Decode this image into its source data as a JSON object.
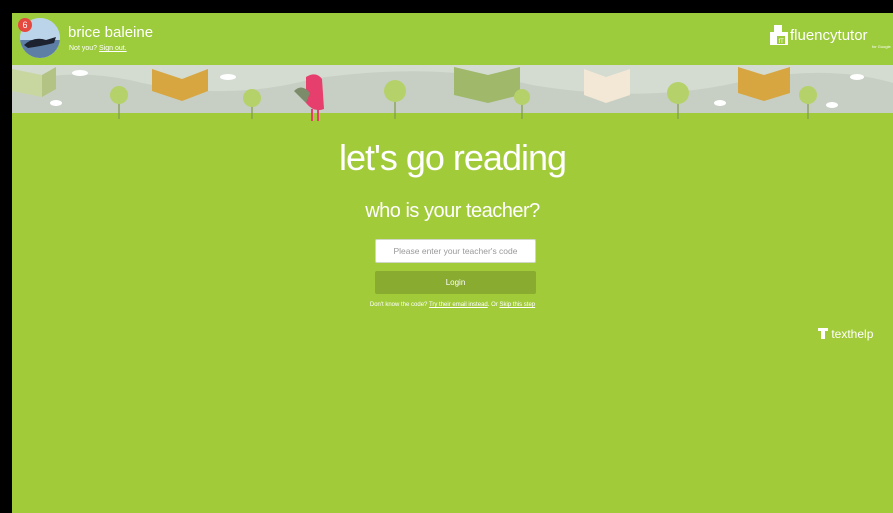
{
  "user": {
    "name": "brice baleine",
    "badge_count": "6",
    "not_you_text": "Not you?",
    "sign_out_link": "Sign out."
  },
  "brand": {
    "name": "fluencytutor",
    "sub": "for Google"
  },
  "main": {
    "title": "let's go reading",
    "subtitle": "who is your teacher?",
    "code_placeholder": "Please enter your teacher's code",
    "login_label": "Login",
    "help_prefix": "Don't know the code?",
    "help_email_link": "Try their email instead",
    "help_or": "Or",
    "help_skip_link": "Skip this step"
  },
  "footer": {
    "texthelp_label": "texthelp"
  },
  "colors": {
    "background": "#a2cb3a",
    "topbar": "#9ccb3b",
    "login_button": "#89ab30"
  }
}
